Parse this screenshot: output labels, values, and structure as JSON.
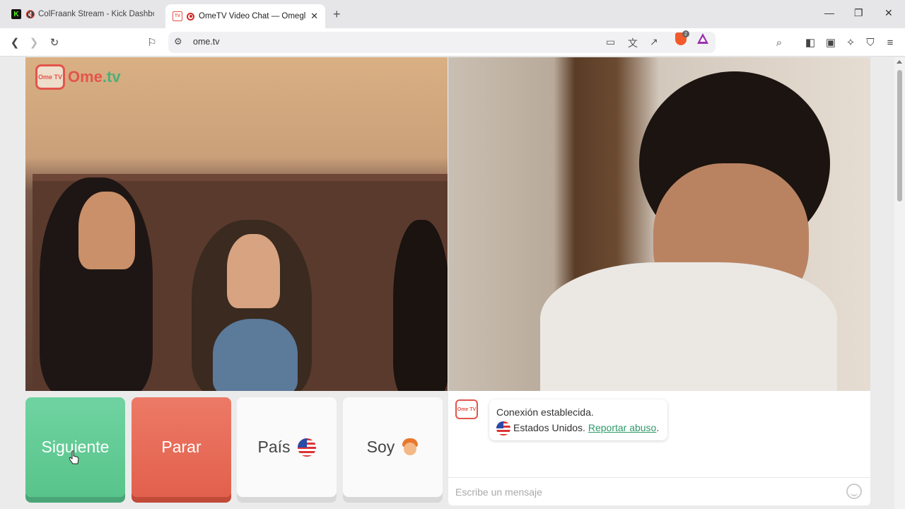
{
  "browser": {
    "tabs": [
      {
        "title": "ColFraank Stream - Kick Dashboa",
        "active": false
      },
      {
        "title": "OmeTV Video Chat — Omegl",
        "active": true
      }
    ],
    "new_tab_label": "+",
    "window_controls": {
      "minimize": "—",
      "restore": "❐",
      "close": "✕"
    },
    "url": "ome.tv",
    "brave_badge": "2"
  },
  "video": {
    "logo_tv": "Ome TV",
    "logo_name_main": "Ome",
    "logo_name_dot": ".tv"
  },
  "controls": {
    "next_label": "Siguiente",
    "stop_label": "Parar",
    "country_label": "País",
    "gender_label": "Soy"
  },
  "chat": {
    "logo_text": "Ome TV",
    "status_line": "Conexión establecida.",
    "country": "Estados Unidos.",
    "report_link": "Reportar abuso",
    "report_suffix": ".",
    "input_placeholder": "Escribe un mensaje"
  },
  "colors": {
    "brand_red": "#e2554b",
    "next_green": "#58c48b",
    "stop_red": "#e2604d",
    "link_green": "#2e9a68"
  }
}
